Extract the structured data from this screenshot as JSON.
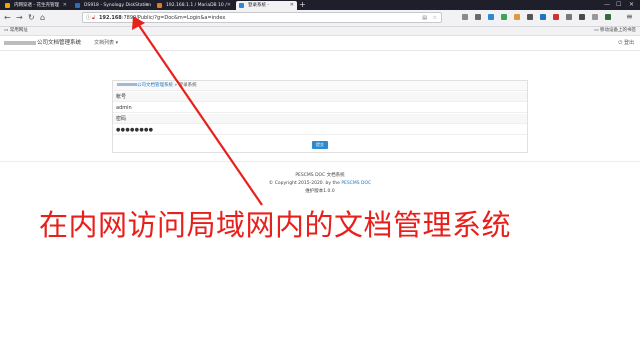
{
  "browser": {
    "tabs": [
      {
        "label": "内网穿透 - 花生壳管理",
        "favicon_color": "#f4a300",
        "active": false
      },
      {
        "label": "DS918 - Synology DiskStation",
        "favicon_color": "#2a6ebb",
        "active": false
      },
      {
        "label": "192.168.1.1 / MariaDB 10 / ",
        "favicon_color": "#e07b1f",
        "active": false
      },
      {
        "label": "登录系统 - ",
        "favicon_color": "#2b8ad0",
        "active": true
      }
    ],
    "new_tab": "+",
    "url": "192.168.1.1:7890/Public/?g=Doc&m=Login&a=index",
    "url_host_bold": "192.168",
    "url_rest": ":7890/Public/?g=Doc&m=Login&a=index",
    "bookmark": "常用网址",
    "mobile_bookmarks": "移动设备上的书签"
  },
  "header": {
    "brand": "公司文档管理系统",
    "docs_menu": "文档列表",
    "logout": "登出"
  },
  "login": {
    "breadcrumb_link": "公司文档管理系统",
    "breadcrumb_sep": " » ",
    "breadcrumb_current": "登录系统",
    "account_label": "帐号",
    "account_value": "admin",
    "password_label": "密码",
    "password_value": "●●●●●●●●",
    "submit": "提交"
  },
  "footer": {
    "title": "PESCMS DOC 文档系统",
    "copyright_prefix": "© Copyright 2015-2020. by the ",
    "copyright_link": "PESCMS DOC",
    "version": "维护版本1.0.0"
  },
  "annotation": {
    "text": "在内网访问局域网内的文档管理系统",
    "color": "#e8201c"
  }
}
